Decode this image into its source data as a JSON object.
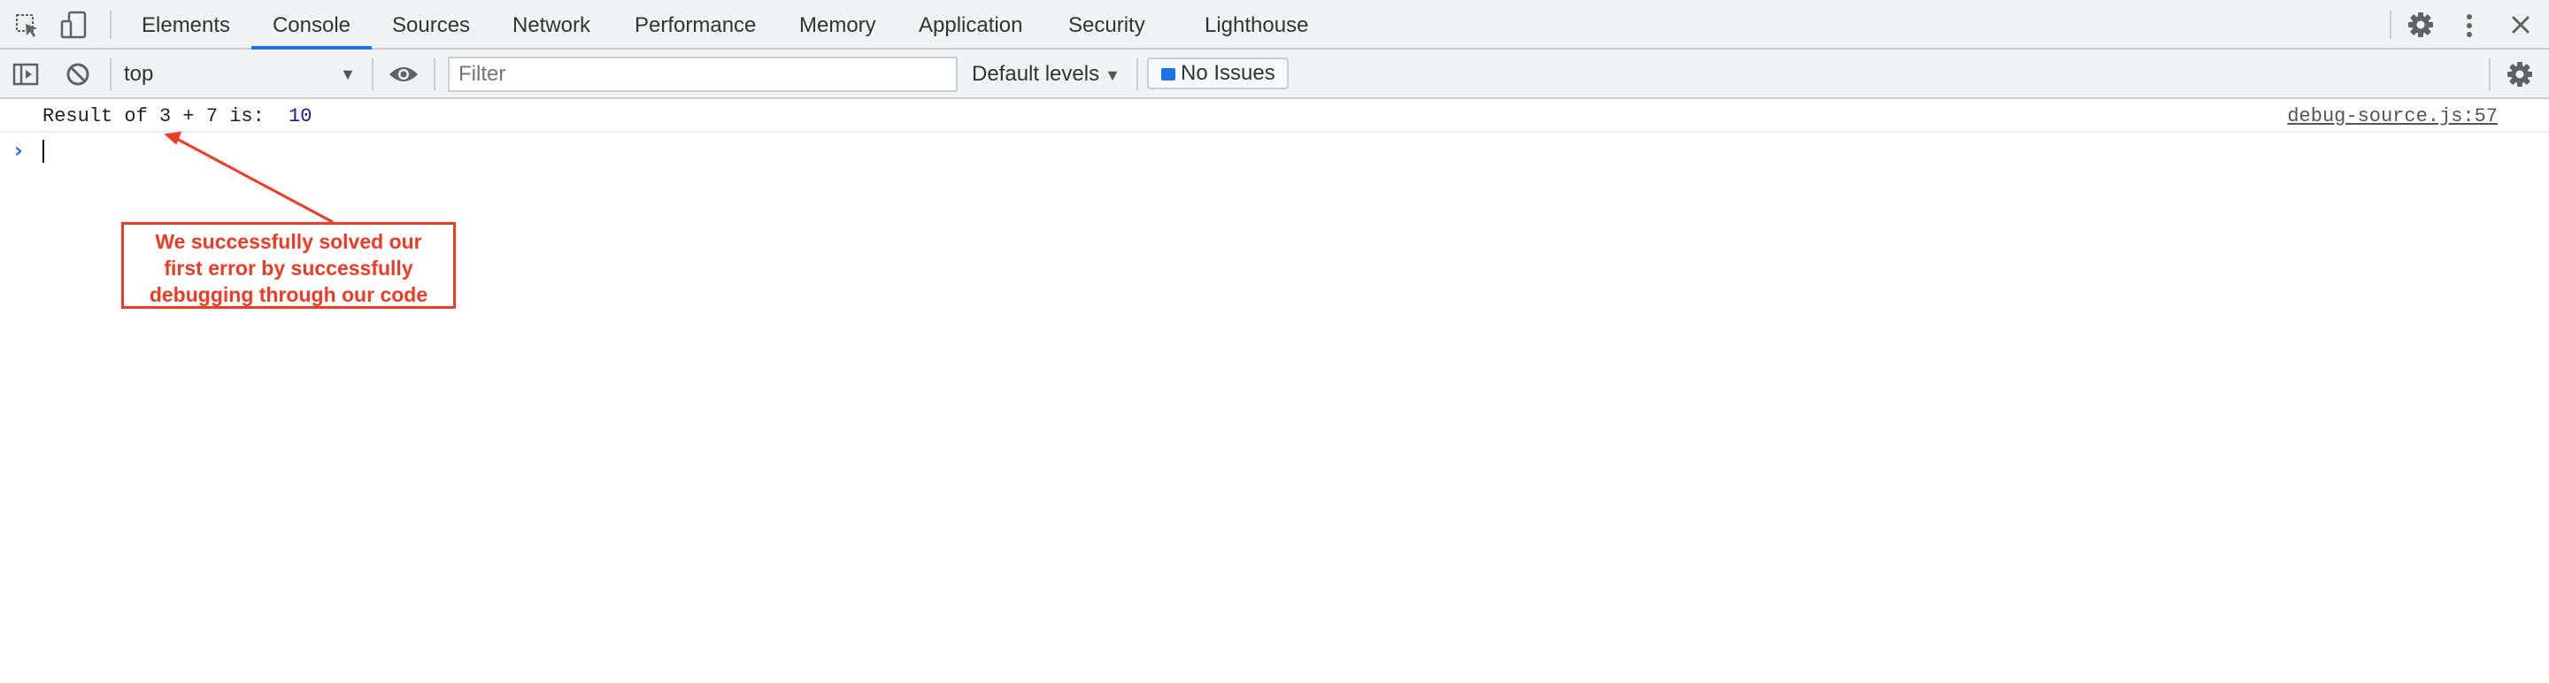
{
  "tabs": [
    {
      "label": "Elements"
    },
    {
      "label": "Console",
      "active": true
    },
    {
      "label": "Sources"
    },
    {
      "label": "Network"
    },
    {
      "label": "Performance"
    },
    {
      "label": "Memory"
    },
    {
      "label": "Application"
    },
    {
      "label": "Security"
    },
    {
      "label": "Lighthouse"
    }
  ],
  "toolbar": {
    "context": "top",
    "filter_placeholder": "Filter",
    "levels": "Default levels",
    "issues": "No Issues"
  },
  "console": {
    "message_text": "Result of 3 + 7 is: ",
    "message_value": "10",
    "source": "debug-source.js:57"
  },
  "annotation": {
    "lines": [
      "We successfully solved our",
      "first error by successfully",
      "debugging through our code"
    ]
  },
  "colors": {
    "accent": "#1a73e8",
    "annotation": "#f03a24",
    "number": "#1a1aa6"
  },
  "icons": [
    "inspect-element-icon",
    "device-toolbar-icon",
    "settings-gear-icon",
    "more-vert-icon",
    "close-icon",
    "sidebar-toggle-icon",
    "clear-console-icon",
    "eye-icon",
    "message-icon"
  ]
}
